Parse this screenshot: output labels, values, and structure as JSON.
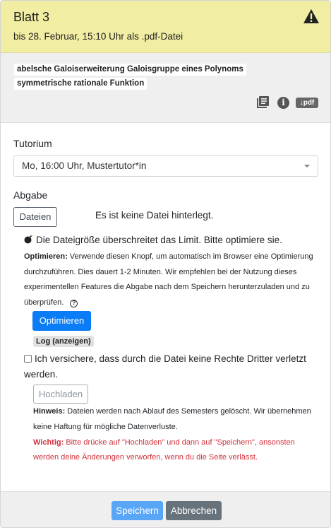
{
  "header": {
    "title": "Blatt 3",
    "deadline": "bis 28. Februar, 15:10 Uhr als .pdf-Datei",
    "warning_icon": "warning-triangle-icon",
    "background": "#f1eda3"
  },
  "tags": [
    "abelsche Galoiserweiterung",
    "Galoisgruppe eines Polynoms",
    "symmetrische rationale Funktion"
  ],
  "tag_icons": {
    "book": "book-icon",
    "info": "i",
    "pdf": "↓pdf"
  },
  "tutorium": {
    "label": "Tutorium",
    "selected": "Mo, 16:00 Uhr, Mustertutor*in"
  },
  "abgabe": {
    "label": "Abgabe",
    "files_button": "Dateien",
    "no_file_text": "Es ist keine Datei hinterlegt."
  },
  "size_warning": {
    "icon": "bomb-icon",
    "text": "Die Dateigröße überschreitet das Limit. Bitte optimiere sie."
  },
  "optimize": {
    "label_bold": "Optimieren:",
    "description": "Verwende diesen Knopf, um automatisch im Browser eine Optimierung durchzuführen. Dies dauert 1-2 Minuten. Wir empfehlen bei der Nutzung dieses experimentellen Features die Abgabe nach dem Speichern herunterzuladen und zu überprüfen.",
    "help_icon": "?",
    "button": "Optimieren",
    "log_badge": "Log (anzeigen)"
  },
  "consent": {
    "text": "Ich versichere, dass durch die Datei keine Rechte Dritter verletzt werden."
  },
  "upload_button": "Hochladen",
  "notes": {
    "hint_bold": "Hinweis:",
    "hint_text": "Dateien werden nach Ablauf des Semesters gelöscht. Wir übernehmen keine Haftung für mögliche Datenverluste.",
    "important_bold": "Wichtig:",
    "important_text": "Bitte drücke auf \"Hochladen\" und dann auf \"Speichern\", ansonsten werden deine Änderungen verworfen, wenn du die Seite verlässt.",
    "important_color": "#d0313b"
  },
  "footer": {
    "save": "Speichern",
    "cancel": "Abbrechen",
    "save_color": "#59a6f7",
    "cancel_color": "#68727b"
  }
}
